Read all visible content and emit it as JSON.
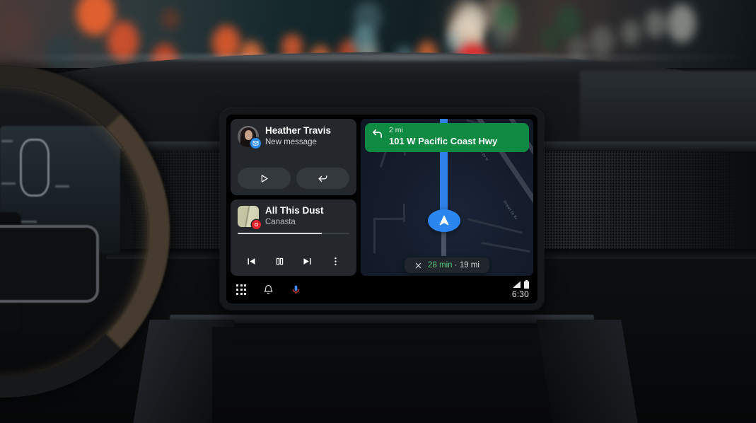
{
  "scene": {
    "description": "Android Auto head unit in a car dashboard at night",
    "background": "blurred night city bokeh lights through windshield"
  },
  "message_card": {
    "sender": "Heather Travis",
    "status": "New message",
    "avatar_name": "avatar",
    "app_badge": "message-badge-icon",
    "play_label": "Play message",
    "reply_label": "Reply"
  },
  "media_card": {
    "title": "All This Dust",
    "artist": "Canasta",
    "album_art_name": "album-art",
    "app_badge": "media-app-badge-icon",
    "progress_percent": 75,
    "controls": {
      "previous": "Previous track",
      "pause": "Pause",
      "next": "Next track",
      "overflow": "More options"
    }
  },
  "navigation": {
    "maneuver_icon": "turn-left-icon",
    "distance": "2 mi",
    "road": "101 W Pacific Coast Hwy",
    "banner_color": "#0f8a43",
    "eta": {
      "close_label": "Close navigation",
      "duration": "28 min",
      "separator": " · ",
      "distance": "19 mi",
      "duration_color": "#56c87c"
    },
    "map": {
      "road_labels": [
        "Ocean Dr N",
        "Ocean Dr W"
      ],
      "route_color": "#2f7fe8",
      "position_marker": "navigation-arrow-icon"
    }
  },
  "statusbar": {
    "apps_label": "All apps",
    "notifications_label": "Notifications",
    "assistant_label": "Google Assistant",
    "signal_label": "Cellular signal",
    "battery_label": "Battery",
    "clock": "6:30"
  }
}
